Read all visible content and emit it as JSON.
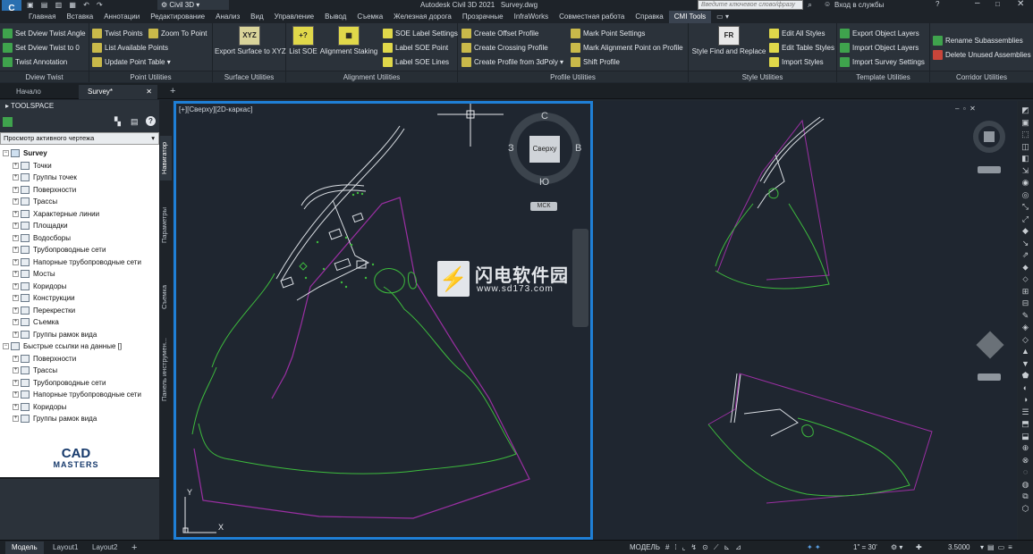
{
  "app": {
    "title": "Autodesk Civil 3D 2021",
    "filename": "Survey.dwg",
    "workspace": "Civil 3D",
    "search_placeholder": "Введите ключевое слово/фразу",
    "signin": "Вход в службы"
  },
  "menu": [
    "Главная",
    "Вставка",
    "Аннотации",
    "Редактирование",
    "Анализ",
    "Вид",
    "Управление",
    "Вывод",
    "Съемка",
    "Железная дорога",
    "Прозрачные",
    "InfraWorks",
    "Совместная работа",
    "Справка",
    "CMI Tools"
  ],
  "menu_active": "CMI Tools",
  "ribbon": {
    "dview": {
      "title": "Dview Twist",
      "items": [
        "Set Dview Twist Angle",
        "Set Dview Twist to 0",
        "Twist Annotation"
      ]
    },
    "point": {
      "title": "Point Utilities",
      "items": [
        "Twist Points",
        "Zoom To Point",
        "List Available Points",
        "Update Point Table"
      ]
    },
    "surface": {
      "title": "Surface Utilities",
      "big": "Export Surface to XYZ",
      "icon_text": "XYZ"
    },
    "alignment": {
      "title": "Alignment Utilities",
      "big1": "List SOE",
      "big2": "Alignment Staking",
      "items": [
        "SOE Label Settings",
        "Label SOE Point",
        "Label SOE Lines"
      ]
    },
    "profile": {
      "title": "Profile Utilities",
      "items": [
        "Create Offset Profile",
        "Create Crossing Profile",
        "Create Profile from 3dPoly",
        "Mark Point Settings",
        "Mark Alignment Point on Profile",
        "Shift Profile"
      ]
    },
    "style": {
      "title": "Style Utilities",
      "big": "Style Find and Replace",
      "items": [
        "Edit All Styles",
        "Edit Table Styles",
        "Import Styles"
      ]
    },
    "template": {
      "title": "Template Utilities",
      "items": [
        "Export Object Layers",
        "Import Object Layers",
        "Import Survey Settings"
      ]
    },
    "corridor": {
      "title": "Corridor Utilities",
      "items": [
        "Rename Subassemblies",
        "Delete Unused Assemblies"
      ]
    }
  },
  "doc_tabs": [
    "Начало",
    "Survey*"
  ],
  "toolspace": {
    "header": "TOOLSPACE",
    "view_select": "Просмотр активного чертежа",
    "root": "Survey",
    "items": [
      "Точки",
      "Группы точек",
      "Поверхности",
      "Трассы",
      "Характерные линии",
      "Площадки",
      "Водосборы",
      "Трубопроводные сети",
      "Напорные трубопроводные сети",
      "Мосты",
      "Коридоры",
      "Конструкции",
      "Перекрестки",
      "Съемка",
      "Группы рамок вида"
    ],
    "refs_root": "Быстрые ссылки на данные []",
    "refs_items": [
      "Поверхности",
      "Трассы",
      "Трубопроводные сети",
      "Напорные трубопроводные сети",
      "Коридоры",
      "Группы рамок вида"
    ],
    "logo_line1": "CAD",
    "logo_line2": "MASTERS"
  },
  "side_tabs": [
    "Навигатор",
    "Параметры",
    "Съемка",
    "Панель инструмен..."
  ],
  "viewport": {
    "label": "[+][Сверху][2D-каркас]",
    "cube_top": "Сверху",
    "north": "С",
    "south": "Ю",
    "west": "З",
    "east": "В",
    "ucs": "МСК",
    "axis_y": "Y",
    "axis_x": "X"
  },
  "watermark": {
    "cn": "闪电软件园",
    "url": "www.sd173.com"
  },
  "layout_tabs": [
    "Модель",
    "Layout1",
    "Layout2"
  ],
  "status": {
    "model": "МОДЕЛЬ",
    "scale": "1\" = 30'",
    "value": "3.5000"
  },
  "colors": {
    "accent": "#1f7fd6",
    "bg": "#212830",
    "boundary": "#9b2fa3",
    "feature": "#3dbb3d",
    "lines": "#d9dde2"
  }
}
